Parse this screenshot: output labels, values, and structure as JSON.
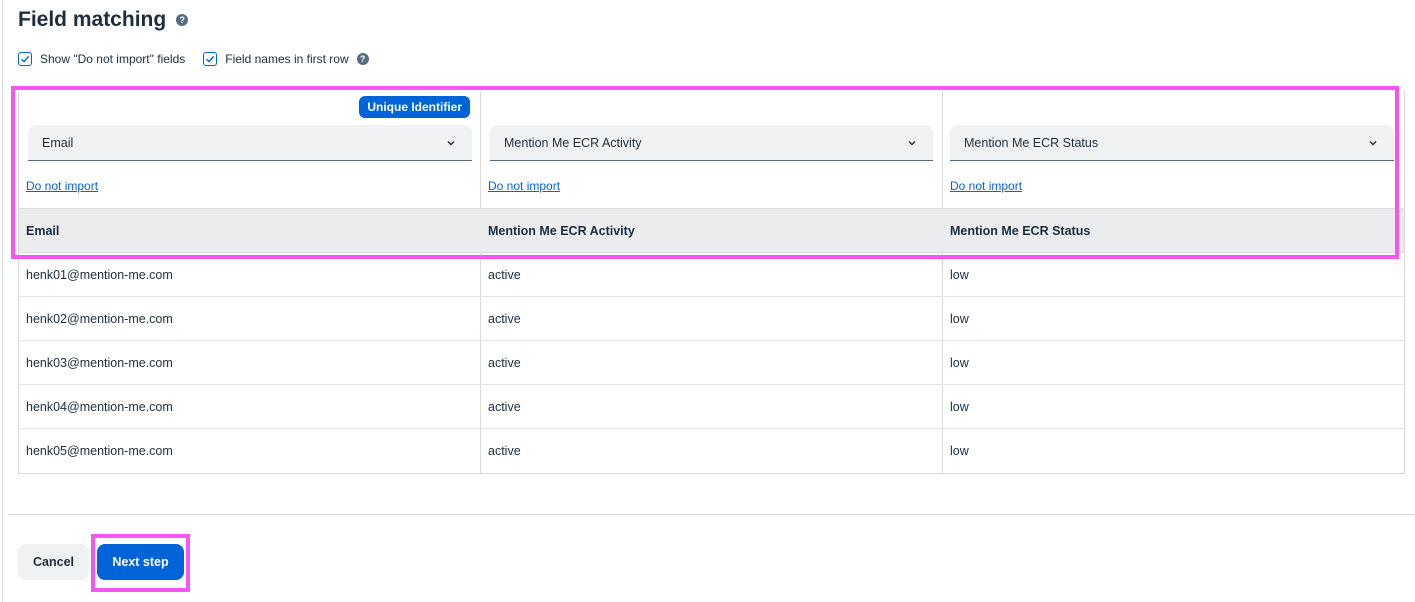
{
  "page": {
    "title": "Field matching"
  },
  "options": {
    "show_do_not_import": {
      "label": "Show \"Do not import\" fields",
      "checked": true
    },
    "field_names_first_row": {
      "label": "Field names in first row",
      "checked": true
    }
  },
  "mapping": {
    "unique_identifier_badge": "Unique Identifier",
    "do_not_import_label": "Do not import",
    "columns": [
      {
        "selected": "Email"
      },
      {
        "selected": "Mention Me ECR Activity"
      },
      {
        "selected": "Mention Me ECR Status"
      }
    ]
  },
  "table": {
    "headers": [
      "Email",
      "Mention Me ECR Activity",
      "Mention Me ECR Status"
    ],
    "rows": [
      [
        "henk01@mention-me.com",
        "active",
        "low"
      ],
      [
        "henk02@mention-me.com",
        "active",
        "low"
      ],
      [
        "henk03@mention-me.com",
        "active",
        "low"
      ],
      [
        "henk04@mention-me.com",
        "active",
        "low"
      ],
      [
        "henk05@mention-me.com",
        "active",
        "low"
      ]
    ]
  },
  "footer": {
    "cancel_label": "Cancel",
    "next_label": "Next step"
  },
  "colors": {
    "accent": "#0064d9",
    "highlight": "#f754f0"
  },
  "icons": {
    "help": "help-circle-icon",
    "checkbox": "check-icon",
    "dropdown": "chevron-down-icon"
  }
}
